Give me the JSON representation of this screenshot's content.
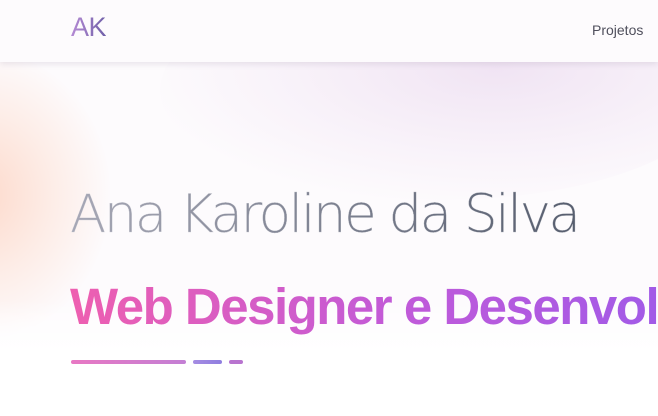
{
  "header": {
    "logo_text": "AK",
    "nav": [
      {
        "label": "Projetos"
      }
    ]
  },
  "hero": {
    "name": "Ana Karoline da Silva",
    "role": "Web Designer e Desenvolvedora"
  },
  "colors": {
    "role_gradient_start": "#ee5fb0",
    "role_gradient_end": "#8f5bf0",
    "name_gradient_start": "#a7a8b6",
    "name_gradient_end": "#565d6e",
    "logo_gradient_start": "#b58ad4",
    "logo_gradient_end": "#6f5fa8"
  }
}
